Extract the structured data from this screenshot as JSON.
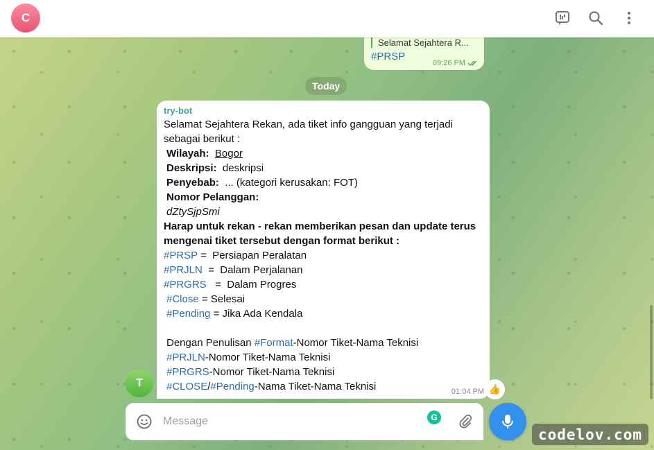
{
  "header": {
    "chat_avatar_letter": "C",
    "icons": [
      "chat-bubble-icon",
      "search-icon",
      "more-vertical-icon"
    ]
  },
  "outgoing": {
    "reply_preview": "Selamat Sejahtera R...",
    "tag": "#PRSP",
    "time": "09:26 PM"
  },
  "date_chip": "Today",
  "incoming": {
    "sender": "try-bot",
    "avatar_letter": "T",
    "intro_1": "Selamat Sejahtera Rekan, ada tiket info gangguan yang terjadi",
    "intro_2": "sebagai berikut :",
    "wilayah_label": "Wilayah:",
    "wilayah_value": "Bogor",
    "deskripsi_label": "Deskripsi:",
    "deskripsi_value": "deskripsi",
    "penyebab_label": "Penyebab:",
    "penyebab_value": "... (kategori kerusakan: FOT)",
    "nomor_label": "Nomor Pelanggan:",
    "nomor_value": "dZtySjpSmi",
    "request_1": "Harap untuk rekan - rekan memberikan pesan dan update terus",
    "request_2": "mengenai tiket tersebut dengan format berikut :",
    "formats": [
      {
        "tag": "#PRSP",
        "text": " =  Persiapan Peralatan"
      },
      {
        "tag": "#PRJLN",
        "text": "  =  Dalam Perjalanan"
      },
      {
        "tag": "#PRGRS",
        "text": "   =  Dalam Progres"
      },
      {
        "tag": "#Close",
        "text": " = Selesai"
      },
      {
        "tag": "#Pending",
        "text": " = Jika Ada Kendala"
      }
    ],
    "writing_prefix": "Dengan Penulisan ",
    "writing_tag": "#Format",
    "writing_suffix": "-Nomor Tiket-Nama Teknisi",
    "examples": [
      {
        "tag": "#PRJLN",
        "text": "-Nomor Tiket-Nama Teknisi"
      },
      {
        "tag": "#PRGRS",
        "text": "-Nomor Tiket-Nama Teknisi"
      }
    ],
    "last_tag_1": "#CLOSE",
    "last_sep": "/",
    "last_tag_2": "#Pending",
    "last_text": "-Nama Tiket-Nama Teknisi",
    "time": "01:04 PM",
    "reaction": "👍"
  },
  "composer": {
    "placeholder": "Message",
    "grammarly_letter": "G"
  },
  "watermark": "codelov.com",
  "colors": {
    "accent": "#3390ec",
    "tag": "#2e6ea5",
    "sender": "#3ca39a",
    "outgoing_bubble": "#effedd"
  }
}
